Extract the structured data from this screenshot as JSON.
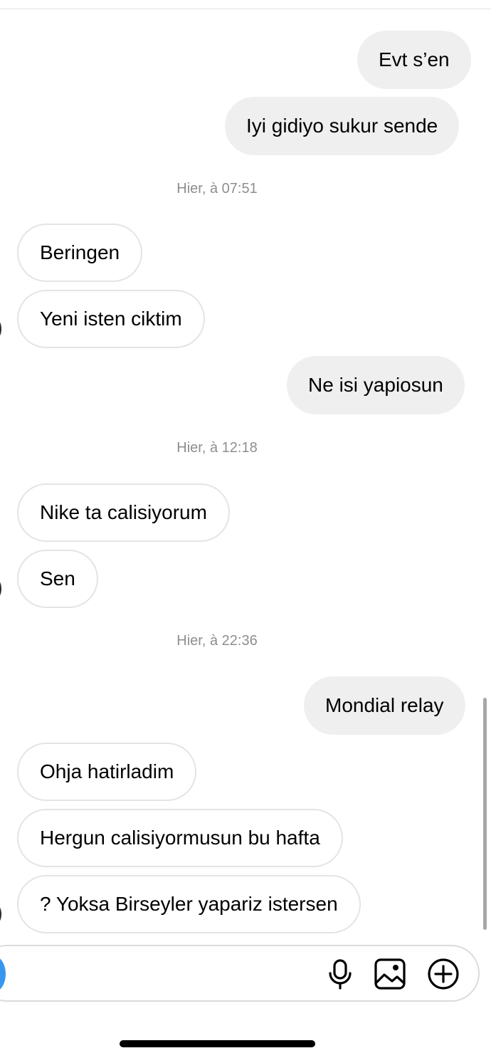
{
  "thread": {
    "messages": [
      {
        "text": "Evt s’en",
        "direction": "outgoing"
      },
      {
        "text": "Iyi gidiyo sukur sende",
        "direction": "outgoing"
      },
      {
        "text": "Beringen",
        "direction": "incoming"
      },
      {
        "text": "Yeni isten ciktim",
        "direction": "incoming"
      },
      {
        "text": "Ne isi yapiosun",
        "direction": "outgoing"
      },
      {
        "text": "Nike ta calisiyorum",
        "direction": "incoming"
      },
      {
        "text": "Sen",
        "direction": "incoming"
      },
      {
        "text": "Mondial relay",
        "direction": "outgoing"
      },
      {
        "text": "Ohja hatirladim",
        "direction": "incoming"
      },
      {
        "text": "Hergun calisiyormusun bu hafta",
        "direction": "incoming"
      },
      {
        "text": "? Yoksa Birseyler yapariz istersen",
        "direction": "incoming"
      }
    ],
    "timestamps": [
      "Hier, à 07:51",
      "Hier, à 12:18",
      "Hier, à 22:36"
    ]
  },
  "composer": {
    "icons": [
      "camera-icon",
      "microphone-icon",
      "gallery-icon",
      "plus-circle-icon"
    ]
  },
  "colors": {
    "outgoing_bubble": "#efefef",
    "incoming_border": "#e4e4e4",
    "timestamp_text": "#8e8e8e",
    "accent_blue": "#3797f0"
  }
}
